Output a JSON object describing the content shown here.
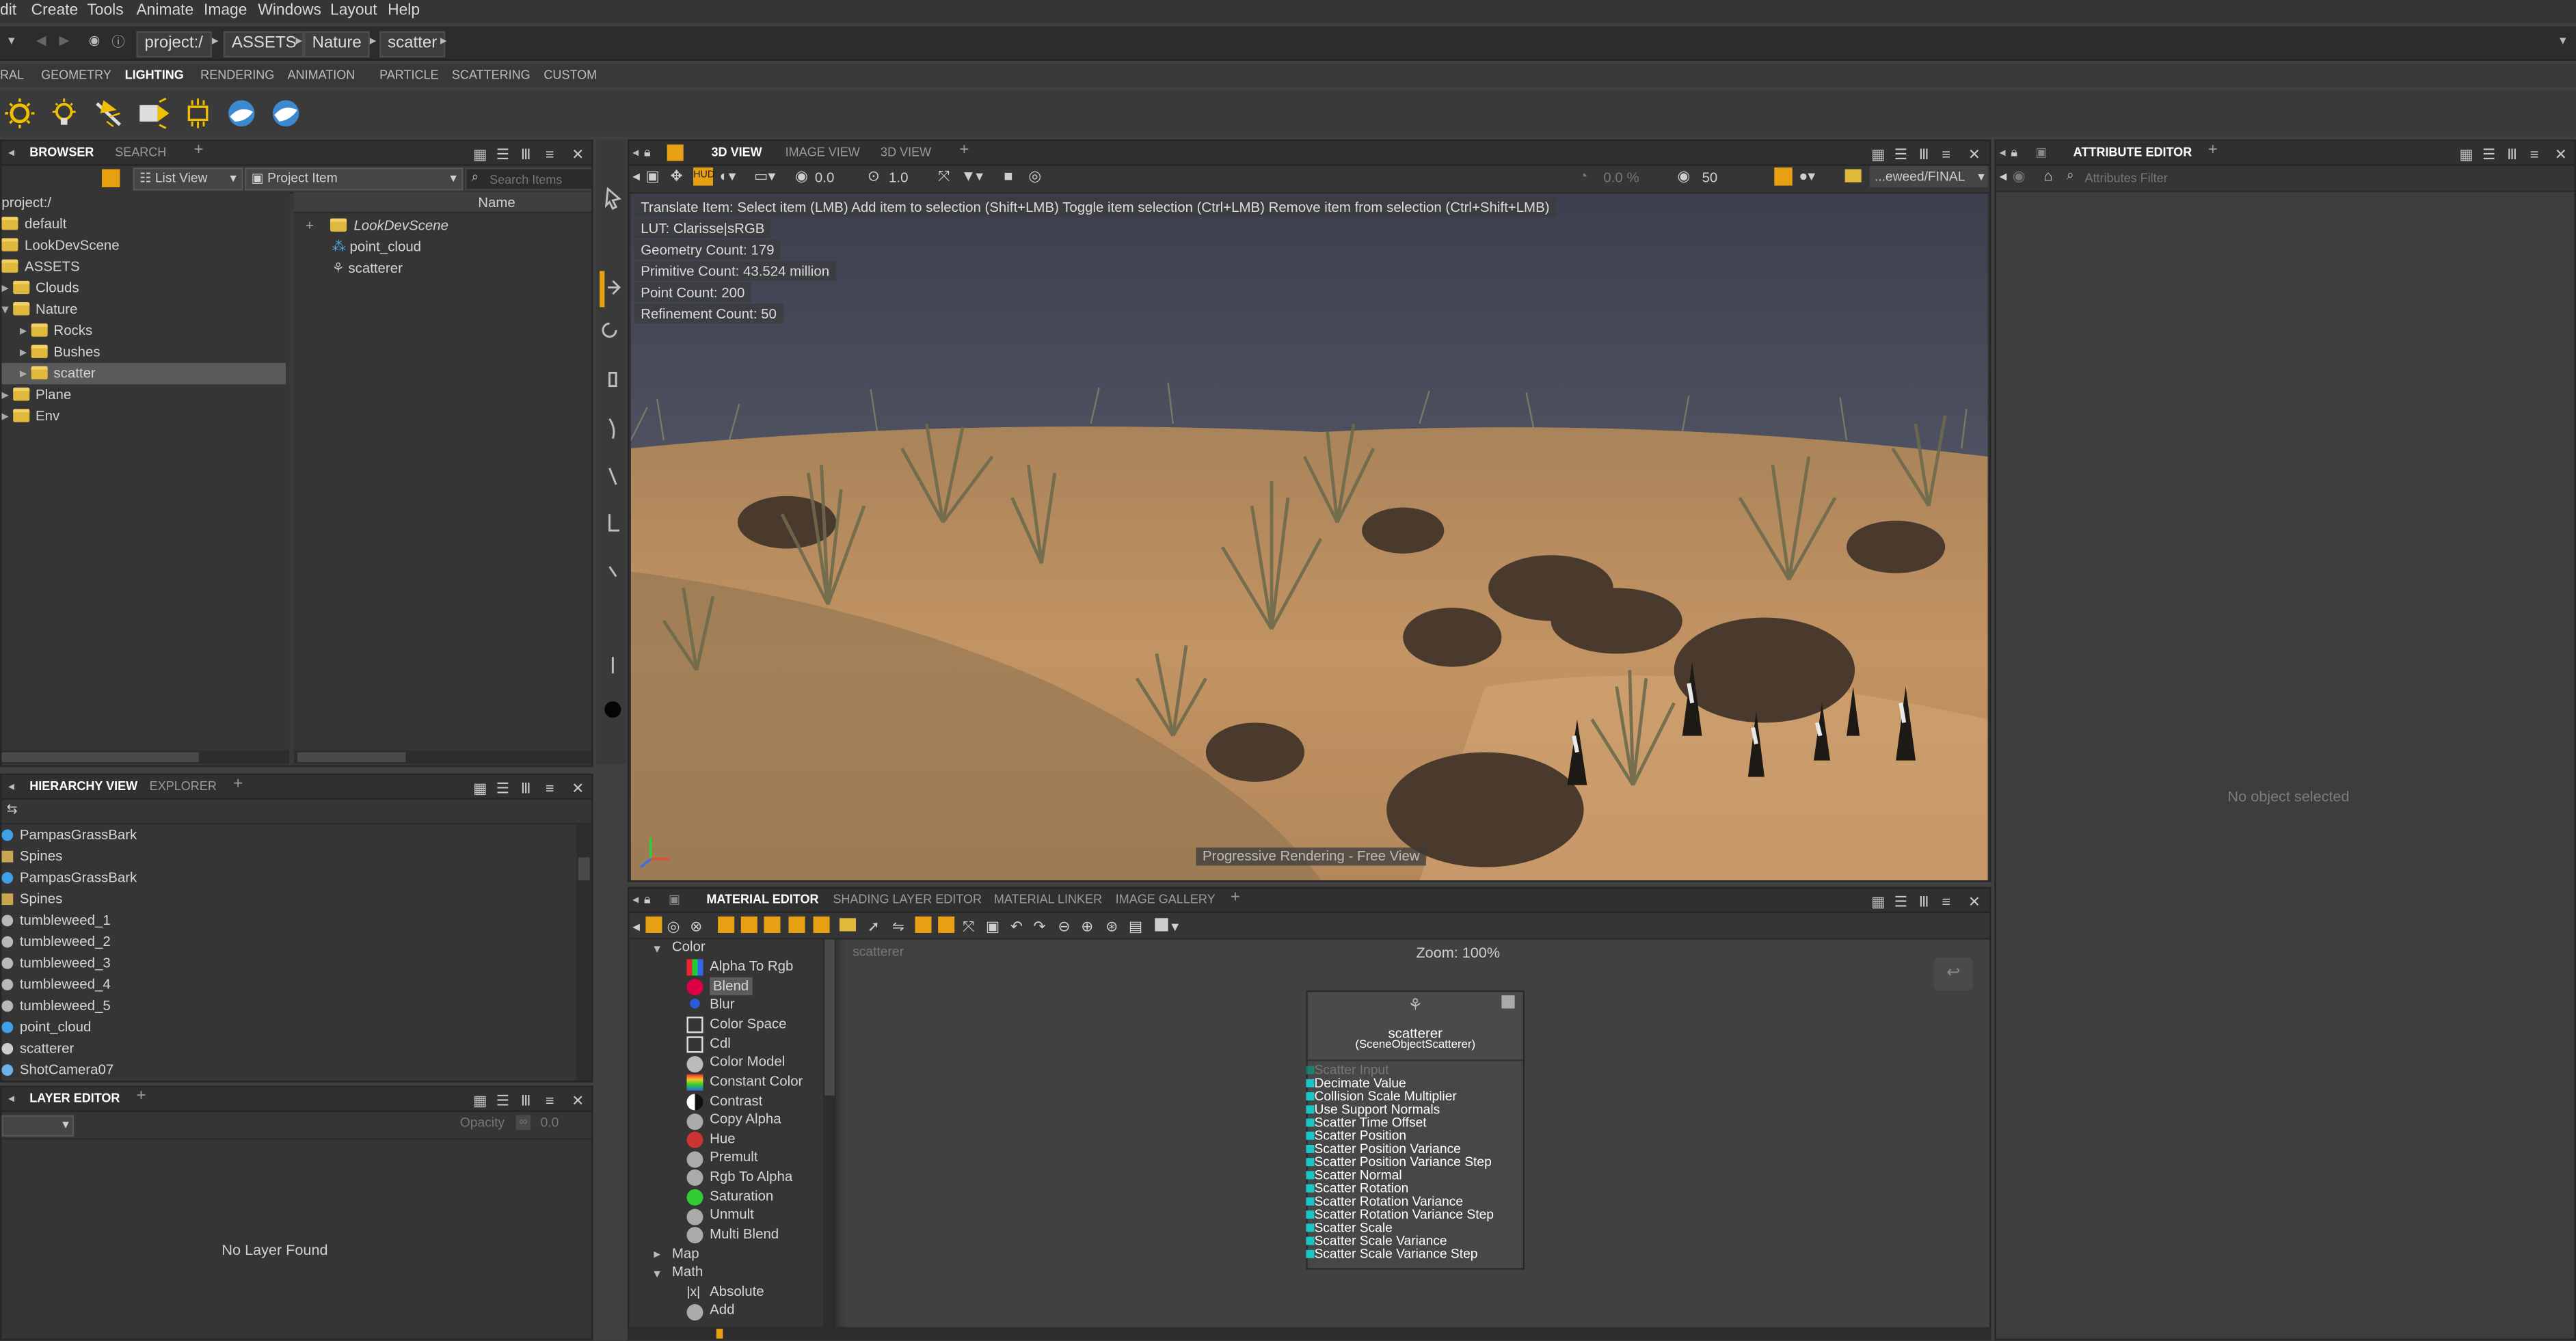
{
  "menu": [
    "dit",
    "Create",
    "Tools",
    "Animate",
    "Image",
    "Windows",
    "Layout",
    "Help"
  ],
  "path": [
    "project:/",
    "ASSETS",
    "Nature",
    "scatter"
  ],
  "shelf_tabs": [
    "RAL",
    "GEOMETRY",
    "LIGHTING",
    "RENDERING",
    "ANIMATION",
    "PARTICLE",
    "SCATTERING",
    "CUSTOM"
  ],
  "shelf_active": "LIGHTING",
  "browser": {
    "tabs": [
      "BROWSER",
      "SEARCH",
      "+"
    ],
    "view_mode": "List View",
    "filter": "Project Item",
    "search_placeholder": "Search Items",
    "column": "Name",
    "tree": [
      "project:/",
      "default",
      "LookDevScene",
      "ASSETS",
      "Clouds",
      "Nature",
      "Rocks",
      "Bushes",
      "scatter",
      "Plane",
      "Env"
    ],
    "items": [
      "LookDevScene",
      "point_cloud",
      "scatterer"
    ]
  },
  "hierarchy": {
    "tabs": [
      "HIERARCHY VIEW",
      "EXPLORER",
      "+"
    ],
    "items": [
      "PampasGrassBark",
      "Spines",
      "PampasGrassBark",
      "Spines",
      "tumbleweed_1",
      "tumbleweed_2",
      "tumbleweed_3",
      "tumbleweed_4",
      "tumbleweed_5",
      "point_cloud",
      "scatterer",
      "ShotCamera07"
    ]
  },
  "layer_editor": {
    "tabs": [
      "LAYER EDITOR",
      "+"
    ],
    "opacity_label": "Opacity",
    "opacity_value": "0.0",
    "empty": "No Layer Found"
  },
  "viewport": {
    "tabs": [
      "3D VIEW",
      "IMAGE VIEW",
      "3D VIEW",
      "+"
    ],
    "field1": "0.0",
    "field2": "1.0",
    "percent": "0.0 %",
    "samples": "50",
    "camera": "...eweed/FINAL",
    "overlay": [
      "Translate Item: Select item (LMB)  Add item to selection (Shift+LMB)  Toggle item selection (Ctrl+LMB)  Remove item from selection (Ctrl+Shift+LMB)",
      "LUT: Clarisse|sRGB",
      "Geometry Count: 179",
      "Primitive Count: 43.524 million",
      "Point Count: 200",
      "Refinement Count: 50"
    ],
    "status": "Progressive Rendering - Free View"
  },
  "material_editor": {
    "tabs": [
      "MATERIAL EDITOR",
      "SHADING LAYER EDITOR",
      "MATERIAL LINKER",
      "IMAGE GALLERY",
      "+"
    ],
    "categories": {
      "color": "Color",
      "map": "Map",
      "math": "Math"
    },
    "color_items": [
      "Alpha To Rgb",
      "Blend",
      "Blur",
      "Color Space",
      "Cdl",
      "Color Model",
      "Constant Color",
      "Contrast",
      "Copy Alpha",
      "Hue",
      "Premult",
      "Rgb To Alpha",
      "Saturation",
      "Unmult",
      "Multi Blend"
    ],
    "math_items": [
      "Absolute",
      "Add"
    ],
    "breadcrumb": "scatterer",
    "zoom": "Zoom: 100%",
    "node": {
      "title": "scatterer",
      "subtitle": "(SceneObjectScatterer)",
      "input": "Scatter Input",
      "ports": [
        "Decimate Value",
        "Collision Scale Multiplier",
        "Use Support Normals",
        "Scatter Time Offset",
        "Scatter Position",
        "Scatter Position Variance",
        "Scatter Position Variance Step",
        "Scatter Normal",
        "Scatter Rotation",
        "Scatter Rotation Variance",
        "Scatter Rotation Variance Step",
        "Scatter Scale",
        "Scatter Scale Variance",
        "Scatter Scale Variance Step"
      ]
    }
  },
  "attribute_editor": {
    "tabs": [
      "ATTRIBUTE EDITOR",
      "+"
    ],
    "filter_placeholder": "Attributes Filter",
    "empty": "No object selected"
  },
  "colors": {
    "accent": "#e8a013",
    "port": "#18c6c6",
    "folder": "#e0b83c"
  }
}
